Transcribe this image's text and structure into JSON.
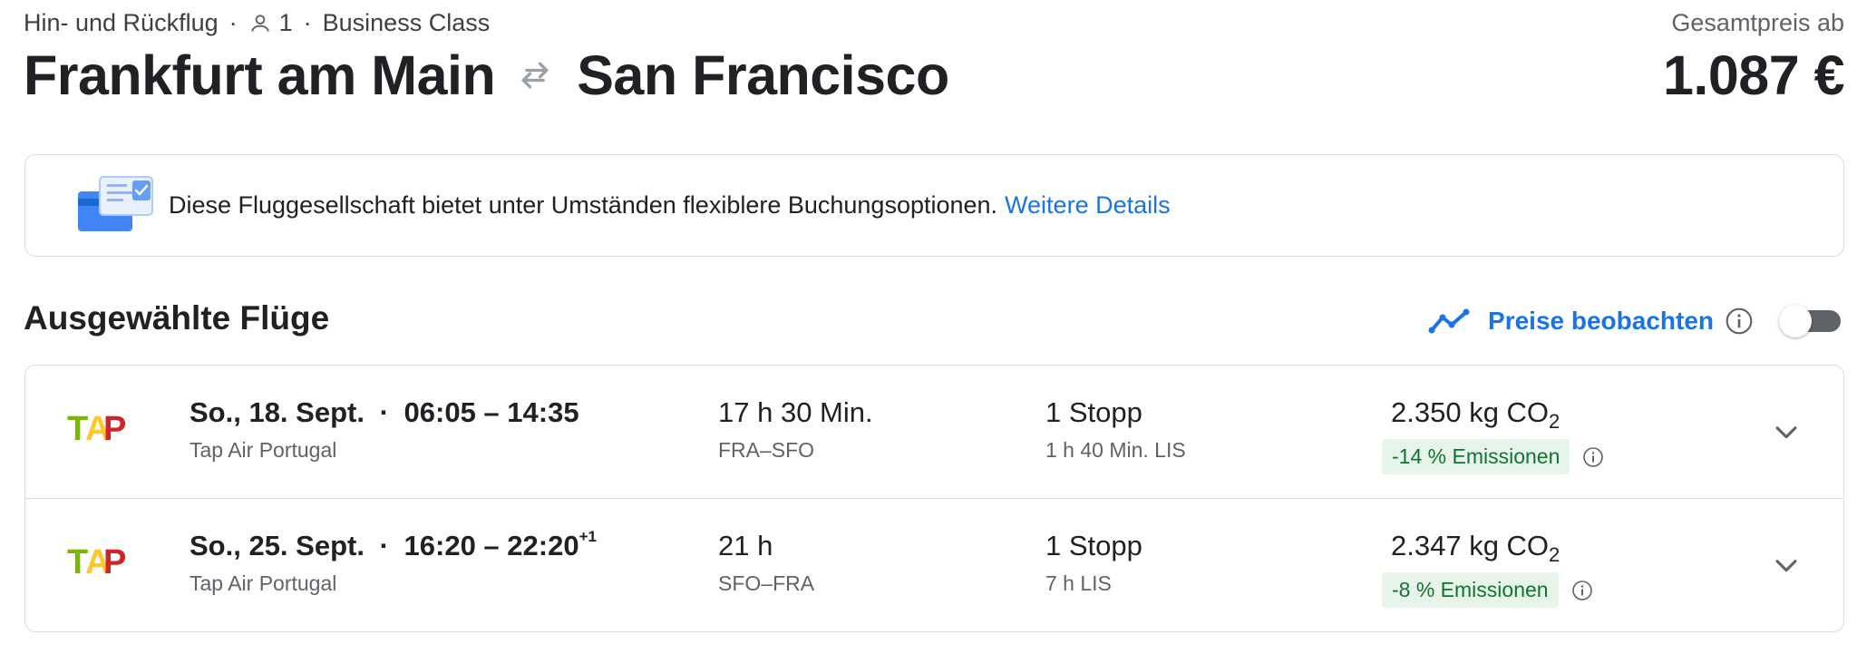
{
  "header": {
    "trip_type": "Hin- und Rückflug",
    "separator": "·",
    "passengers": "1",
    "cabin_class": "Business Class",
    "origin": "Frankfurt am Main",
    "destination": "San Francisco",
    "total_label": "Gesamtpreis ab",
    "total_price": "1.087 €"
  },
  "notice": {
    "text": "Diese Fluggesellschaft bietet unter Umständen flexiblere Buchungsoptionen.",
    "link": "Weitere Details"
  },
  "selected": {
    "title": "Ausgewählte Flüge",
    "track_label": "Preise beobachten",
    "track_enabled": false
  },
  "flights": [
    {
      "date": "So., 18. Sept.",
      "dot": "·",
      "times": "06:05 – 14:35",
      "day_offset": "",
      "airline": "Tap Air Portugal",
      "duration": "17 h 30 Min.",
      "route": "FRA–SFO",
      "stops": "1 Stopp",
      "layover": "1 h 40 Min. LIS",
      "co2": "2.350 kg CO",
      "co2_sub": "2",
      "emissions": "-14 % Emissionen"
    },
    {
      "date": "So., 25. Sept.",
      "dot": "·",
      "times": "16:20 – 22:20",
      "day_offset": "+1",
      "airline": "Tap Air Portugal",
      "duration": "21 h",
      "route": "SFO–FRA",
      "stops": "1 Stopp",
      "layover": "7 h LIS",
      "co2": "2.347 kg CO",
      "co2_sub": "2",
      "emissions": "-8 % Emissionen"
    }
  ],
  "colors": {
    "accent": "#1a73e8",
    "text": "#202124",
    "secondary_text": "#5f6368",
    "border": "#dadce0",
    "badge_bg": "#e6f4ea",
    "badge_text": "#137333",
    "tap_green": "#7ab800",
    "tap_red": "#d0232a",
    "tap_yellow": "#ffc72c"
  },
  "icons": {
    "person": "person-icon",
    "swap": "swap-arrows-icon",
    "notice": "booking-options-icon",
    "track": "price-trend-icon",
    "info": "info-icon",
    "expand": "chevron-down-icon",
    "airline": "tap-air-portugal-logo"
  }
}
